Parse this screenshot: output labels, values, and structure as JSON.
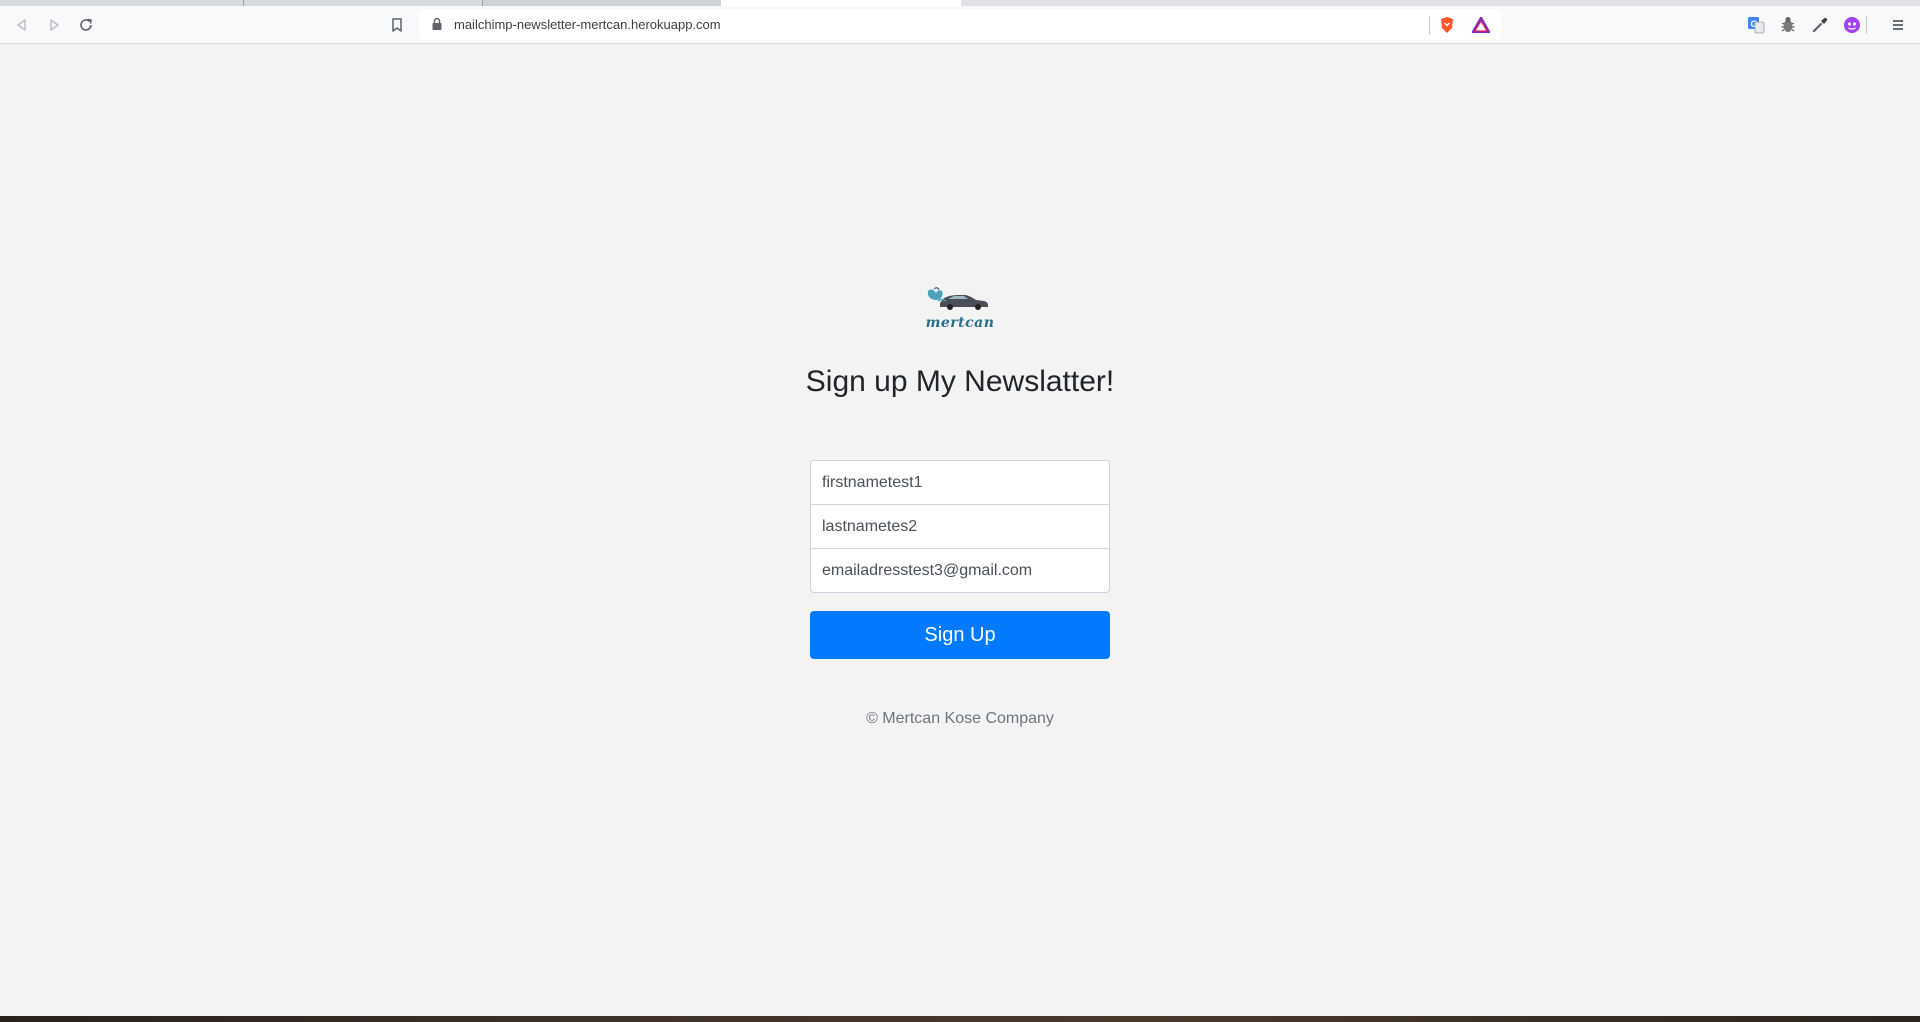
{
  "browser": {
    "url": "mailchimp-newsletter-mertcan.herokuapp.com",
    "back_icon": "back-arrow-icon",
    "forward_icon": "forward-arrow-icon",
    "reload_icon": "reload-icon",
    "bookmark_icon": "bookmark-icon",
    "lock_icon": "lock-icon",
    "extensions": [
      "brave-shields-icon",
      "brave-rewards-icon",
      "translate-icon",
      "bug-icon",
      "eyedropper-icon",
      "profile-icon",
      "menu-icon"
    ]
  },
  "page": {
    "logo_text": "mertcan",
    "heading": "Sign up My Newslatter!",
    "form": {
      "first_name_value": "firstnametest1",
      "last_name_value": "lastnametes2",
      "email_value": "emailadresstest3@gmail.com"
    },
    "signup_label": "Sign Up",
    "footer": "© Mertcan Kose Company"
  },
  "colors": {
    "primary": "#007bff",
    "background": "#f3f3f3",
    "brand_logo": "#2a6f8a"
  }
}
